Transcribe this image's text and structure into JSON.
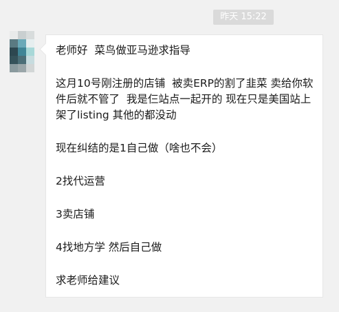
{
  "timestamp": "昨天 15:22",
  "avatar_colors": [
    "#e8eaea",
    "#c9cfd0",
    "#d8dcdc",
    "#5a7a82",
    "#6aa9b8",
    "#e6eeef",
    "#2d4750",
    "#3f8596",
    "#a8d8d8",
    "#35525a",
    "#4b6e77",
    "#c7dcdf",
    "#8a9a9e",
    "#9aa6a9",
    "#d2d6d6"
  ],
  "message": {
    "paragraphs": [
      "老师好  菜鸟做亚马逊求指导",
      "这月10号刚注册的店铺  被卖ERP的割了韭菜 卖给你软件后就不管了  我是仨站点一起开的 现在只是美国站上架了listing 其他的都没动",
      "现在纠结的是1自己做（啥也不会）",
      "2找代运营",
      "3卖店铺",
      "4找地方学 然后自己做",
      "求老师给建议"
    ]
  }
}
